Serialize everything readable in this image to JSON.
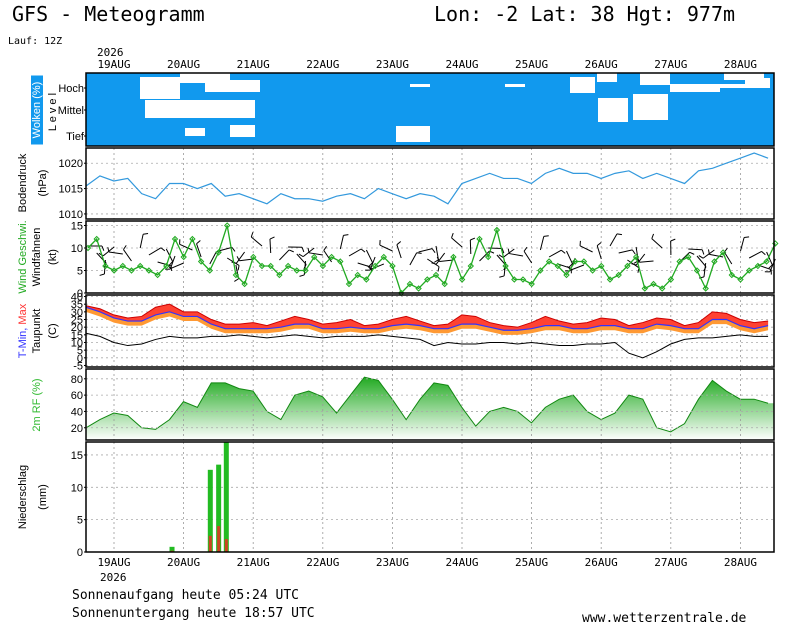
{
  "header": {
    "title": "GFS - Meteogramm",
    "location": "Lon: -2 Lat: 38 Hgt: 977m",
    "run": "Lauf: 12Z"
  },
  "x_axis": {
    "year": "2026",
    "dates": [
      "19AUG",
      "20AUG",
      "21AUG",
      "22AUG",
      "23AUG",
      "24AUG",
      "25AUG",
      "26AUG",
      "27AUG",
      "28AUG"
    ]
  },
  "footer": {
    "sunrise": "Sonnenaufgang heute 05:24 UTC",
    "sunset": "Sonnenuntergang heute 18:57 UTC",
    "source": "www.wetterzentrale.de"
  },
  "colors": {
    "cloud_bg": "#1199ee",
    "temp_fill": "#ff3333",
    "temp_fill_2": "#ff9933",
    "tmin_line": "#3333ff",
    "humidity": "#33bb33",
    "precip": "#22bb22",
    "precip_conv": "#cc4422",
    "wind": "#22aa22"
  },
  "chart_data": [
    {
      "type": "heatmap",
      "panel": "clouds",
      "ylabel_1": "Wolken (%)",
      "ylabel_2": "L e v e l",
      "levels": [
        "Hoch",
        "Mittel",
        "Tief"
      ]
    },
    {
      "type": "line",
      "panel": "pressure",
      "ylabel_1": "Bodendruck",
      "ylabel_2": "(hPa)",
      "yticks": [
        1010,
        1015,
        1020
      ],
      "ylim": [
        1009,
        1023
      ],
      "x_days": [
        0.0,
        0.2,
        0.4,
        0.6,
        0.8,
        1.0,
        1.2,
        1.4,
        1.6,
        1.8,
        2.0,
        2.2,
        2.4,
        2.6,
        2.8,
        3.0,
        3.2,
        3.4,
        3.6,
        3.8,
        4.0,
        4.2,
        4.4,
        4.6,
        4.8,
        5.0,
        5.2,
        5.4,
        5.6,
        5.8,
        6.0,
        6.2,
        6.4,
        6.6,
        6.8,
        7.0,
        7.2,
        7.4,
        7.6,
        7.8,
        8.0,
        8.2,
        8.4,
        8.6,
        8.8,
        9.0,
        9.2,
        9.4,
        9.6,
        9.8
      ],
      "values": [
        1015.5,
        1017.5,
        1016.5,
        1017,
        1014,
        1013,
        1016,
        1016,
        1015,
        1016,
        1013.5,
        1014,
        1013,
        1012,
        1014,
        1013,
        1013,
        1012.5,
        1013.5,
        1014,
        1013,
        1015,
        1014,
        1013,
        1014,
        1013.5,
        1012,
        1016,
        1017,
        1018,
        1017,
        1017,
        1016,
        1018,
        1019,
        1018,
        1018,
        1017,
        1018,
        1018.5,
        1017,
        1018,
        1017,
        1016,
        1018.5,
        1019,
        1020,
        1021,
        1022,
        1021
      ]
    },
    {
      "type": "line",
      "panel": "wind",
      "ylabel_1": "Wind Geschwi.",
      "ylabel_2": "Windfahnen",
      "ylabel_3": "(kt)",
      "yticks": [
        0,
        5,
        10,
        15
      ],
      "ylim": [
        0,
        16
      ],
      "x_days": [
        0.0,
        0.125,
        0.25,
        0.375,
        0.5,
        0.625,
        0.75,
        0.875,
        1.0,
        1.125,
        1.25,
        1.375,
        1.5,
        1.625,
        1.75,
        1.875,
        2.0,
        2.125,
        2.25,
        2.375,
        2.5,
        2.625,
        2.75,
        2.875,
        3.0,
        3.125,
        3.25,
        3.375,
        3.5,
        3.625,
        3.75,
        3.875,
        4.0,
        4.125,
        4.25,
        4.375,
        4.5,
        4.625,
        4.75,
        4.875,
        5.0,
        5.125,
        5.25,
        5.375,
        5.5,
        5.625,
        5.75,
        5.875,
        6.0,
        6.125,
        6.25,
        6.375,
        6.5,
        6.625,
        6.75,
        6.875,
        7.0,
        7.125,
        7.25,
        7.375,
        7.5,
        7.625,
        7.75,
        7.875,
        8.0,
        8.125,
        8.25,
        8.375,
        8.5,
        8.625,
        8.75,
        8.875,
        9.0,
        9.125,
        9.25,
        9.375,
        9.5,
        9.625,
        9.75,
        9.875
      ],
      "values": [
        10,
        12,
        6,
        5,
        6,
        5,
        6,
        5,
        4,
        6,
        12,
        8,
        12,
        7,
        5,
        9,
        15,
        4,
        2,
        8,
        6,
        6,
        4,
        6,
        5,
        5,
        8,
        6,
        8,
        7,
        2,
        4,
        3,
        6,
        8,
        6,
        0,
        2,
        1,
        3,
        4,
        2,
        8,
        3,
        6,
        12,
        8,
        14,
        6,
        3,
        3,
        2,
        5,
        7,
        6,
        4,
        7,
        7,
        5,
        6,
        3,
        4,
        6,
        8,
        1,
        2,
        1,
        3,
        7,
        8,
        5,
        1,
        7,
        9,
        4,
        3,
        5,
        6,
        7,
        11
      ]
    },
    {
      "type": "area",
      "panel": "temperature",
      "ylabel_1": "T-Min, Max",
      "ylabel_2": "Taupunkt",
      "ylabel_3": "(C)",
      "yticks": [
        -5,
        0,
        5,
        10,
        15,
        20,
        25,
        30,
        35,
        40
      ],
      "ylim": [
        -6,
        41
      ],
      "x_days": [
        0.0,
        0.2,
        0.4,
        0.6,
        0.8,
        1.0,
        1.2,
        1.4,
        1.6,
        1.8,
        2.0,
        2.2,
        2.4,
        2.6,
        2.8,
        3.0,
        3.2,
        3.4,
        3.6,
        3.8,
        4.0,
        4.2,
        4.4,
        4.6,
        4.8,
        5.0,
        5.2,
        5.4,
        5.6,
        5.8,
        6.0,
        6.2,
        6.4,
        6.6,
        6.8,
        7.0,
        7.2,
        7.4,
        7.6,
        7.8,
        8.0,
        8.2,
        8.4,
        8.6,
        8.8,
        9.0,
        9.2,
        9.4,
        9.6,
        9.8
      ],
      "series": [
        {
          "name": "Max",
          "values": [
            34,
            32,
            28,
            26,
            27,
            33,
            35,
            30,
            30,
            25,
            22,
            22,
            23,
            21,
            24,
            27,
            25,
            22,
            23,
            25,
            21,
            22,
            25,
            27,
            24,
            21,
            22,
            28,
            27,
            23,
            21,
            20,
            23,
            27,
            24,
            22,
            23,
            26,
            25,
            21,
            23,
            26,
            25,
            21,
            23,
            30,
            29,
            25,
            23,
            24
          ]
        },
        {
          "name": "Min",
          "values": [
            33,
            30,
            26,
            24,
            24,
            28,
            30,
            27,
            27,
            22,
            19,
            19,
            19,
            19,
            20,
            22,
            22,
            19,
            19,
            20,
            19,
            19,
            21,
            22,
            21,
            19,
            19,
            22,
            22,
            20,
            18,
            18,
            19,
            21,
            21,
            19,
            19,
            21,
            21,
            19,
            19,
            22,
            21,
            19,
            19,
            25,
            25,
            21,
            19,
            21
          ]
        },
        {
          "name": "Taupunkt",
          "values": [
            16,
            14,
            10,
            8,
            9,
            12,
            14,
            13,
            13,
            14,
            14,
            15,
            14,
            13,
            14,
            15,
            14,
            13,
            14,
            14,
            14,
            15,
            14,
            13,
            12,
            8,
            10,
            9,
            9,
            10,
            10,
            9,
            10,
            9,
            8,
            8,
            9,
            9,
            10,
            3,
            0,
            4,
            9,
            12,
            13,
            13,
            14,
            15,
            14,
            14
          ]
        }
      ]
    },
    {
      "type": "area",
      "panel": "humidity",
      "ylabel_1": "2m RF (%)",
      "yticks": [
        20,
        40,
        60,
        80
      ],
      "ylim": [
        5,
        92
      ],
      "x_days": [
        0.0,
        0.2,
        0.4,
        0.6,
        0.8,
        1.0,
        1.2,
        1.4,
        1.6,
        1.8,
        2.0,
        2.2,
        2.4,
        2.6,
        2.8,
        3.0,
        3.2,
        3.4,
        3.6,
        3.8,
        4.0,
        4.2,
        4.4,
        4.6,
        4.8,
        5.0,
        5.2,
        5.4,
        5.6,
        5.8,
        6.0,
        6.2,
        6.4,
        6.6,
        6.8,
        7.0,
        7.2,
        7.4,
        7.6,
        7.8,
        8.0,
        8.2,
        8.4,
        8.6,
        8.8,
        9.0,
        9.2,
        9.4,
        9.6,
        9.8
      ],
      "values": [
        20,
        30,
        38,
        35,
        20,
        18,
        30,
        52,
        45,
        75,
        75,
        68,
        65,
        40,
        30,
        60,
        65,
        58,
        38,
        60,
        82,
        78,
        55,
        30,
        55,
        75,
        72,
        45,
        22,
        40,
        45,
        40,
        26,
        45,
        55,
        60,
        40,
        30,
        38,
        60,
        55,
        20,
        15,
        25,
        55,
        78,
        65,
        55,
        55,
        50
      ]
    },
    {
      "type": "bar",
      "panel": "precipitation",
      "ylabel_1": "Niederschlag",
      "ylabel_2": "(mm)",
      "yticks": [
        0,
        5,
        10,
        15
      ],
      "ylim": [
        0,
        17
      ],
      "x_days": [
        1.2,
        1.75,
        1.87,
        1.98
      ],
      "values": [
        0.8,
        12.7,
        13.5,
        17.0
      ],
      "convective": [
        0.2,
        2.5,
        4.0,
        2.0
      ]
    }
  ]
}
